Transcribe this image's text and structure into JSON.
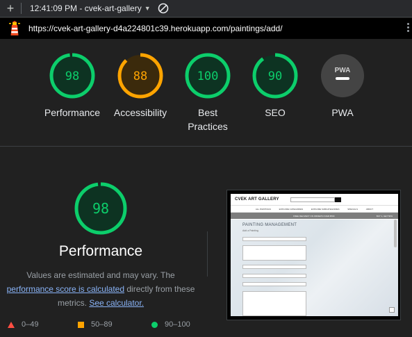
{
  "toolbar": {
    "new_tab_symbol": "+",
    "title": "12:41:09 PM - cvek-art-gallery",
    "dropdown_icon": "caret-down-icon",
    "block_icon": "block-icon"
  },
  "urlbar": {
    "url": "https://cvek-art-gallery-d4a224801c39.herokuapp.com/paintings/add/",
    "site_icon": "lighthouse-icon",
    "menu_icon": "kebab-menu-icon"
  },
  "colors": {
    "pass": "#0cce6b",
    "average": "#ffa400",
    "fail": "#ff4e42",
    "pwa": "#444444"
  },
  "categories": [
    {
      "label": "Performance",
      "score": "98",
      "status": "pass"
    },
    {
      "label": "Accessibility",
      "score": "88",
      "status": "average"
    },
    {
      "label": "Best Practices",
      "score": "100",
      "status": "pass"
    },
    {
      "label": "SEO",
      "score": "90",
      "status": "pass"
    },
    {
      "label": "PWA",
      "score": "",
      "status": "pwa",
      "badge": "PWA"
    }
  ],
  "performance": {
    "score": "98",
    "title": "Performance",
    "desc_prefix": "Values are estimated and may vary. The",
    "score_link": "performance score is calculated",
    "desc_middle": "directly from these metrics.",
    "calc_link": "See calculator."
  },
  "legend": [
    {
      "shape": "triangle",
      "range": "0–49"
    },
    {
      "shape": "square",
      "range": "50–89"
    },
    {
      "shape": "circle",
      "range": "90–100"
    }
  ],
  "screenshot": {
    "logo": "CVEK ART GALLERY",
    "nav": [
      "ALL PAINTINGS",
      "EXPLORE CATEGORIES",
      "EXPLORE SUBCATEGORIES",
      "SPECIALS",
      "ABOUT"
    ],
    "promo_left": "FREE DELIVERY ON ORDERS OVER €500",
    "promo_right": "BUY 1, GET 50%",
    "heading": "PAINTING MANAGEMENT",
    "subheading": "Add a Painting"
  }
}
